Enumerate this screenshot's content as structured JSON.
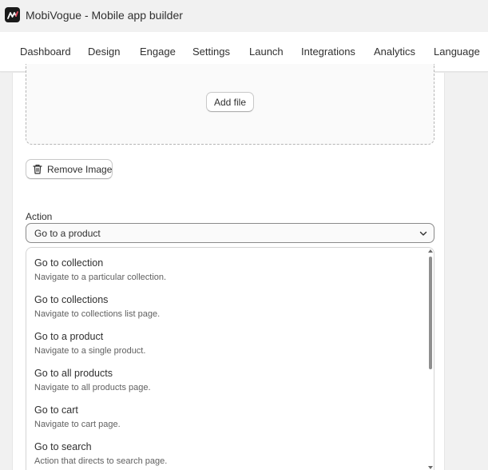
{
  "app": {
    "title": "MobiVogue - Mobile app builder",
    "logo_icon": "mobivogue-logo-icon"
  },
  "nav": {
    "items": [
      "Dashboard",
      "Design",
      "Engage",
      "Settings",
      "Launch",
      "Integrations",
      "Analytics",
      "Language"
    ]
  },
  "upload": {
    "add_file_label": "Add file",
    "remove_image_label": "Remove Image",
    "remove_icon": "trash-icon"
  },
  "action": {
    "label": "Action",
    "selected": "Go to a product",
    "dropdown_icon": "chevron-down-icon",
    "options": [
      {
        "title": "Go to collection",
        "description": "Navigate to a particular collection."
      },
      {
        "title": "Go to collections",
        "description": "Navigate to collections list page."
      },
      {
        "title": "Go to a product",
        "description": "Navigate to a single product."
      },
      {
        "title": "Go to all products",
        "description": "Navigate to all products page."
      },
      {
        "title": "Go to cart",
        "description": "Navigate to cart page."
      },
      {
        "title": "Go to search",
        "description": "Action that directs to search page."
      }
    ]
  },
  "colors": {
    "background": "#f1f1f1",
    "card": "#ffffff",
    "text": "#303030",
    "muted_text": "#616161"
  }
}
